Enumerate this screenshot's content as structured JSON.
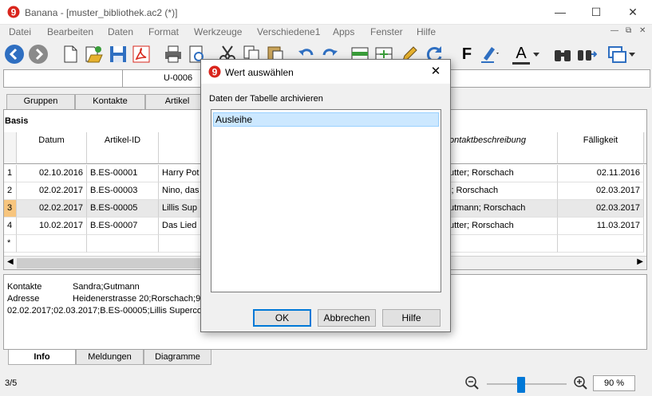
{
  "window": {
    "title": "Banana - [muster_bibliothek.ac2 (*)]"
  },
  "menu": [
    "Datei",
    "Bearbeiten",
    "Daten",
    "Format",
    "Werkzeuge",
    "Verschiedene1",
    "Apps",
    "Fenster",
    "Hilfe"
  ],
  "toolbar": {
    "icons": [
      "back-icon",
      "forward-icon",
      "new-file-icon",
      "open-file-icon",
      "save-icon",
      "pdf-icon",
      "print-icon",
      "preview-icon",
      "cut-icon",
      "copy-icon",
      "paste-icon",
      "undo-icon",
      "redo-icon",
      "add-rows-icon",
      "insert-rows-icon",
      "edit-pen-icon",
      "refresh-icon",
      "bold-icon",
      "highlight-icon",
      "font-color-icon",
      "find-icon",
      "find-next-icon",
      "window-switch-icon"
    ],
    "bold_label": "F",
    "font_color_label": "A"
  },
  "cell_bar": {
    "value": "U-0006"
  },
  "top_tabs": [
    "Gruppen",
    "Kontakte",
    "Artikel"
  ],
  "table": {
    "title": "Basis",
    "columns": [
      "Datum",
      "Artikel-ID",
      "",
      "ontaktbeschreibung",
      "Fälligkeit"
    ],
    "rows": [
      {
        "num": "1",
        "datum": "02.10.2016",
        "artikel": "B.ES-00001",
        "titel": "Harry Pot",
        "kontakt": "utter; Rorschach",
        "faellig": "02.11.2016"
      },
      {
        "num": "2",
        "datum": "02.02.2017",
        "artikel": "B.ES-00003",
        "titel": "Nino, das",
        "kontakt": "i; Rorschach",
        "faellig": "02.03.2017"
      },
      {
        "num": "3",
        "datum": "02.02.2017",
        "artikel": "B.ES-00005",
        "titel": "Lillis Sup",
        "kontakt": "utmann; Rorschach",
        "faellig": "02.03.2017"
      },
      {
        "num": "4",
        "datum": "10.02.2017",
        "artikel": "B.ES-00007",
        "titel": "Das Lied",
        "kontakt": "utter; Rorschach",
        "faellig": "11.03.2017"
      }
    ],
    "new_row_marker": "*",
    "selected_row": "3"
  },
  "info": {
    "line1_label": "Kontakte",
    "line1_value": "Sandra;Gutmann",
    "line2_label": "Adresse",
    "line2_value": "Heidenerstrasse 20;Rorschach;9",
    "line3": "02.02.2017;02.03.2017;B.ES-00005;Lillis Superco"
  },
  "bottom_tabs": [
    "Info",
    "Meldungen",
    "Diagramme"
  ],
  "status": {
    "record": "3/5",
    "zoom": "90  %",
    "zoom_level_percent": 90
  },
  "dialog": {
    "title": "Wert auswählen",
    "label": "Daten der Tabelle archivieren",
    "items": [
      "Ausleihe"
    ],
    "ok": "OK",
    "cancel": "Abbrechen",
    "help": "Hilfe"
  },
  "colors": {
    "accent": "#0078d7",
    "selection": "#cce8ff",
    "logo_red": "#d9251c",
    "pdf_red": "#d7261b",
    "nav_blue": "#2f6fc1"
  }
}
